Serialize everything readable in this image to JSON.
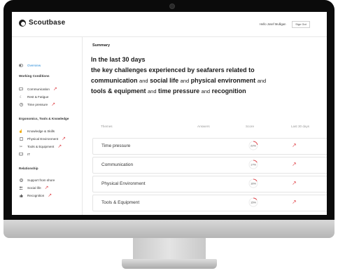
{
  "app": {
    "name": "Scoutbase"
  },
  "header": {
    "greeting": "Hello Josef Mulligan",
    "signout_label": "Sign Out"
  },
  "sidebar": {
    "overview": "Overview",
    "sections": [
      {
        "title": "Working Conditions",
        "items": [
          "Communication",
          "Rest & Fatigue",
          "Time pressure"
        ]
      },
      {
        "title": "Ergonomics, Tools & Knowledge",
        "items": [
          "Knowledge & Skills",
          "Physical Environment",
          "Tools & Equipment",
          "IT"
        ]
      },
      {
        "title": "Relationship",
        "items": [
          "Support from shore",
          "Social life",
          "Recognition"
        ]
      }
    ]
  },
  "main": {
    "summary_label": "Summary",
    "headline": {
      "line1": "In the last 30 days",
      "line2": "the key challenges experienced by seafarers related to",
      "t1": "communication",
      "and1": "and",
      "t2": "social life",
      "and2": "and",
      "t3": "physical environment",
      "and3": "and",
      "t4": "tools & equipment",
      "and4": "and",
      "t5": "time pressure",
      "and5": "and",
      "t6": "recognition"
    },
    "table": {
      "headers": [
        "Themes",
        "Answers",
        "Score",
        "Last 30 days"
      ],
      "rows": [
        {
          "theme": "Time pressure",
          "score": "22%",
          "score_value": 22
        },
        {
          "theme": "Communication",
          "score": "17%",
          "score_value": 17
        },
        {
          "theme": "Physical Environment",
          "score": "16%",
          "score_value": 16
        },
        {
          "theme": "Tools & Equipment",
          "score": "15%",
          "score_value": 15
        }
      ]
    }
  },
  "colors": {
    "accent": "#2a8cd8",
    "alert": "#e0464c",
    "text": "#1a1a1a"
  },
  "icons": {
    "trend": "trend-up-arrow-icon",
    "logo": "scoutbase-logo-icon"
  }
}
